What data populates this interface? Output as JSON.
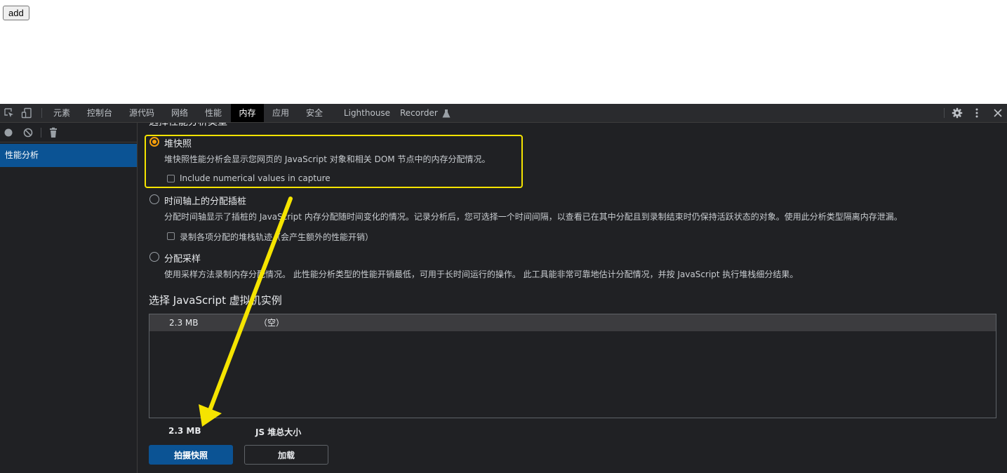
{
  "page": {
    "add_button": "add"
  },
  "devtools": {
    "tabs": [
      "元素",
      "控制台",
      "源代码",
      "网络",
      "性能",
      "内存",
      "应用",
      "安全",
      "Lighthouse",
      "Recorder"
    ],
    "active_tab": "内存",
    "sidebar": {
      "items": [
        {
          "label": "性能分析",
          "selected": true
        }
      ]
    },
    "memory": {
      "profile_type_heading": "选择性能分析类型",
      "options": [
        {
          "title": "堆快照",
          "description": "堆快照性能分析会显示您网页的 JavaScript 对象和相关 DOM 节点中的内存分配情况。",
          "checkbox_label": "Include numerical values in capture",
          "selected": true
        },
        {
          "title": "时间轴上的分配插桩",
          "description": "分配时间轴显示了插桩的 JavaScript 内存分配随时间变化的情况。记录分析后，您可选择一个时间间隔，以查看已在其中分配且到录制结束时仍保持活跃状态的对象。使用此分析类型隔离内存泄漏。",
          "checkbox_label": "录制各项分配的堆栈轨迹（会产生额外的性能开销）",
          "selected": false
        },
        {
          "title": "分配采样",
          "description": "使用采样方法录制内存分配情况。 此性能分析类型的性能开销最低，可用于长时间运行的操作。 此工具能非常可靠地估计分配情况，并按 JavaScript 执行堆栈细分结果。",
          "selected": false
        }
      ],
      "vm_section_title": "选择 JavaScript 虚拟机实例",
      "vm_instances": [
        {
          "size": "2.3 MB",
          "name": "（空）"
        }
      ],
      "summary": {
        "total_size": "2.3 MB",
        "label": "JS 堆总大小"
      },
      "take_snapshot_button": "拍摄快照",
      "load_button": "加载"
    }
  },
  "colors": {
    "accent": "#0b5394",
    "radio_checked": "#f59e0b",
    "annotation": "#f5e400",
    "panel_bg": "#202124"
  }
}
